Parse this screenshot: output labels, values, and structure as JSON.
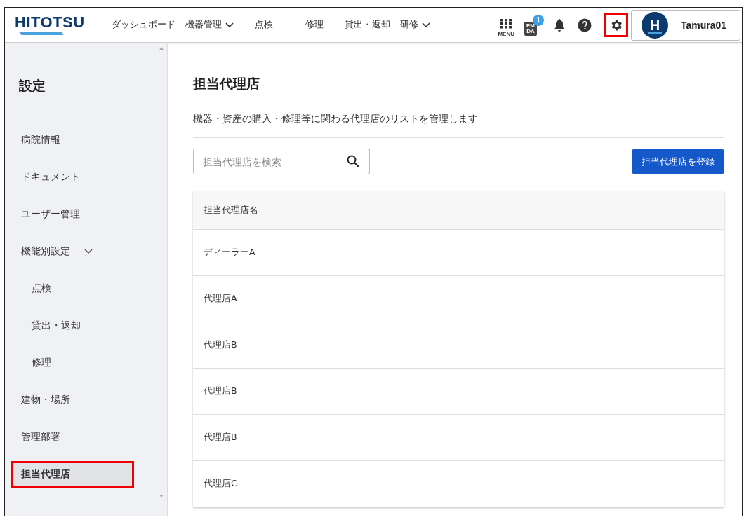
{
  "header": {
    "logo": "HITOTSU",
    "nav": [
      {
        "label": "ダッシュボード",
        "dropdown": false
      },
      {
        "label": "機器管理",
        "dropdown": true
      },
      {
        "label": "点検",
        "dropdown": false
      },
      {
        "label": "修理",
        "dropdown": false
      },
      {
        "label": "貸出・返却",
        "dropdown": false
      },
      {
        "label": "研修",
        "dropdown": true
      }
    ],
    "menu_label": "MENU",
    "pmda_label": "PM DA",
    "pmda_badge": "1",
    "settings_highlighted": true,
    "avatar_letter": "H",
    "user": "Tamura01"
  },
  "sidebar": {
    "title": "設定",
    "items": [
      {
        "label": "病院情報",
        "kind": "item",
        "selected": false,
        "highlighted": false
      },
      {
        "label": "ドキュメント",
        "kind": "item",
        "selected": false,
        "highlighted": false
      },
      {
        "label": "ユーザー管理",
        "kind": "item",
        "selected": false,
        "highlighted": false
      },
      {
        "label": "機能別設定",
        "kind": "group",
        "expanded": true,
        "selected": false,
        "highlighted": false
      },
      {
        "label": "点検",
        "kind": "sub",
        "selected": false,
        "highlighted": false
      },
      {
        "label": "貸出・返却",
        "kind": "sub",
        "selected": false,
        "highlighted": false
      },
      {
        "label": "修理",
        "kind": "sub",
        "selected": false,
        "highlighted": false
      },
      {
        "label": "建物・場所",
        "kind": "item",
        "selected": false,
        "highlighted": false
      },
      {
        "label": "管理部署",
        "kind": "item",
        "selected": false,
        "highlighted": false
      },
      {
        "label": "担当代理店",
        "kind": "item",
        "selected": true,
        "highlighted": true
      }
    ]
  },
  "main": {
    "title": "担当代理店",
    "description": "機器・資産の購入・修理等に関わる代理店のリストを管理します",
    "search": {
      "placeholder": "担当代理店を検索"
    },
    "register_button": "担当代理店を登録",
    "table": {
      "columns": [
        "担当代理店名"
      ],
      "rows": [
        [
          "ディーラーA"
        ],
        [
          "代理店A"
        ],
        [
          "代理店B"
        ],
        [
          "代理店B"
        ],
        [
          "代理店B"
        ],
        [
          "代理店C"
        ]
      ]
    }
  }
}
